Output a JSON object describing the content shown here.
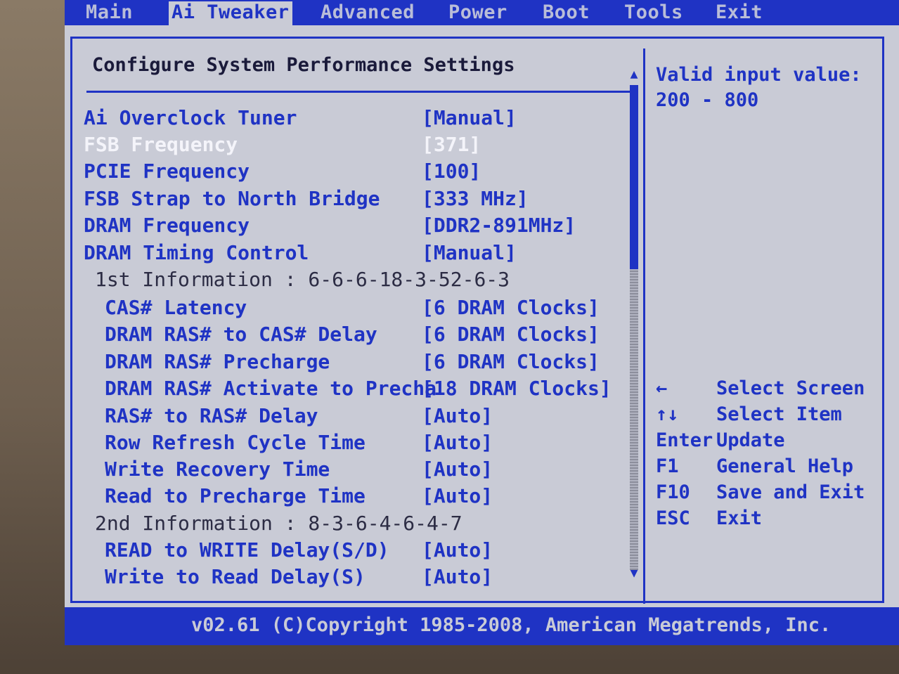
{
  "tabs": [
    {
      "label": "Main"
    },
    {
      "label": "Ai Tweaker"
    },
    {
      "label": "Advanced"
    },
    {
      "label": "Power"
    },
    {
      "label": "Boot"
    },
    {
      "label": "Tools"
    },
    {
      "label": "Exit"
    }
  ],
  "active_tab": "Ai Tweaker",
  "panel": {
    "title": "Configure System Performance Settings"
  },
  "settings": [
    {
      "label": "Ai Overclock Tuner",
      "value": "[Manual]"
    },
    {
      "label": "FSB Frequency",
      "value": "[371]",
      "selected": true
    },
    {
      "label": "PCIE Frequency",
      "value": "[100]"
    },
    {
      "label": "FSB Strap to North Bridge",
      "value": "[333 MHz]"
    },
    {
      "label": "DRAM Frequency",
      "value": "[DDR2-891MHz]"
    },
    {
      "label": "DRAM Timing Control",
      "value": "[Manual]"
    },
    {
      "label": "1st Information : 6-6-6-18-3-52-6-3",
      "value": ""
    },
    {
      "label": "CAS# Latency",
      "value": "[6 DRAM Clocks]"
    },
    {
      "label": "DRAM RAS# to CAS# Delay",
      "value": "[6 DRAM Clocks]"
    },
    {
      "label": "DRAM RAS# Precharge",
      "value": "[6 DRAM Clocks]"
    },
    {
      "label": "DRAM RAS# Activate to Precha",
      "value": "[18 DRAM Clocks]"
    },
    {
      "label": "RAS# to RAS# Delay",
      "value": "[Auto]"
    },
    {
      "label": "Row Refresh Cycle Time",
      "value": "[Auto]"
    },
    {
      "label": "Write Recovery Time",
      "value": "[Auto]"
    },
    {
      "label": "Read to Precharge Time",
      "value": "[Auto]"
    },
    {
      "label": "2nd Information : 8-3-6-4-6-4-7",
      "value": ""
    },
    {
      "label": "READ to WRITE Delay(S/D)",
      "value": "[Auto]"
    },
    {
      "label": "Write to Read Delay(S)",
      "value": "[Auto]"
    }
  ],
  "help": {
    "line1": "Valid input value:",
    "line2": "200 - 800"
  },
  "keys": [
    {
      "key": "←",
      "desc": " Select Screen"
    },
    {
      "key": "↑↓",
      "desc": "Select Item"
    },
    {
      "key": "Enter",
      "desc": "Update"
    },
    {
      "key": "F1",
      "desc": "General Help"
    },
    {
      "key": "F10",
      "desc": "Save and Exit"
    },
    {
      "key": "ESC",
      "desc": "Exit"
    }
  ],
  "footer": "v02.61 (C)Copyright 1985-2008, American Megatrends, Inc.",
  "colors": {
    "accent": "#1f33c4",
    "background": "#c9cbd6",
    "selected_text": "#f4f4fa"
  }
}
